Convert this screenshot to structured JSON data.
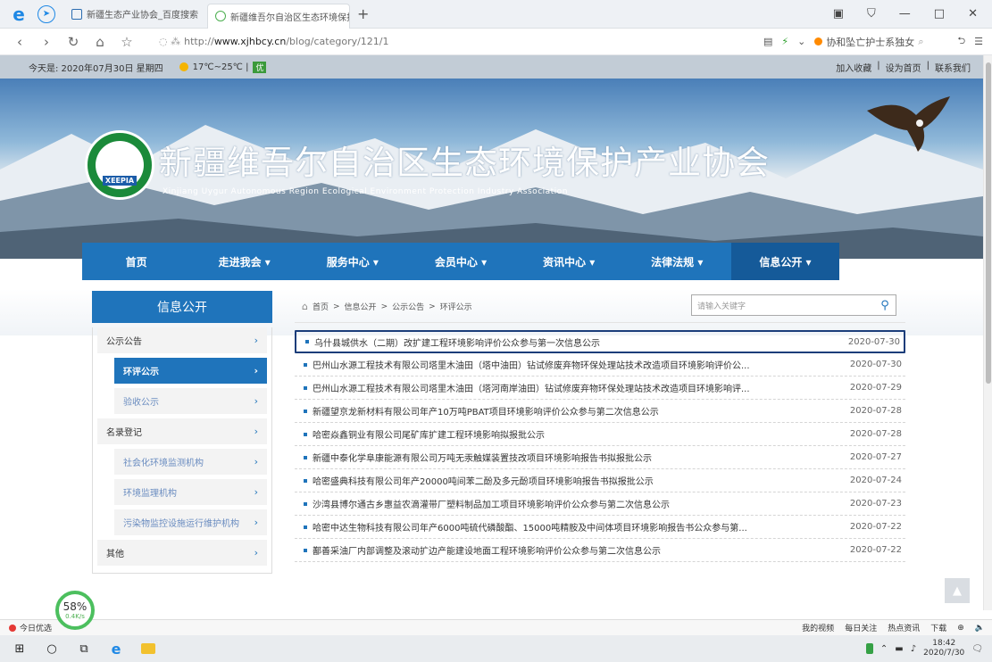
{
  "browser": {
    "tabs": [
      {
        "label": "新疆生态产业协会_百度搜索",
        "active": false
      },
      {
        "label": "新疆维吾尔自治区生态环境保护",
        "active": true
      }
    ],
    "url_prefix": "http://",
    "url_domain": "www.xjhbcy.cn",
    "url_path": "/blog/category/121/1",
    "search_text": "协和坠亡护士系独女",
    "win_min": "—",
    "win_max": "□",
    "win_close": "✕"
  },
  "topbar": {
    "date": "今天是: 2020年07月30日 星期四",
    "temp": "17℃~25℃ |",
    "air": "优",
    "links": [
      "加入收藏",
      "|",
      "设为首页",
      "|",
      "联系我们"
    ]
  },
  "banner": {
    "title": "新疆维吾尔自治区生态环境保护产业协会",
    "subtitle": "Xinjiang Uygur Autonomous Region Ecological Environment Protection Industry Association",
    "logo_text": "XEEPIA"
  },
  "nav": [
    {
      "label": "首页",
      "on": false
    },
    {
      "label": "走进我会 ▾",
      "on": false
    },
    {
      "label": "服务中心 ▾",
      "on": false
    },
    {
      "label": "会员中心 ▾",
      "on": false
    },
    {
      "label": "资讯中心 ▾",
      "on": false
    },
    {
      "label": "法律法规 ▾",
      "on": false
    },
    {
      "label": "信息公开 ▾",
      "on": true
    }
  ],
  "sidebar": {
    "title": "信息公开",
    "items": [
      {
        "label": "公示公告",
        "arrow": "›"
      },
      {
        "label": "环评公示",
        "arrow": "›"
      },
      {
        "label": "验收公示",
        "arrow": "›"
      },
      {
        "label": "名录登记",
        "arrow": "›"
      },
      {
        "label": "社会化环境监测机构",
        "arrow": "›"
      },
      {
        "label": "环境监理机构",
        "arrow": "›"
      },
      {
        "label": "污染物监控设施运行维护机构",
        "arrow": "›"
      },
      {
        "label": "其他",
        "arrow": "›"
      }
    ]
  },
  "breadcrumb": {
    "home": "首页",
    "sep": ">",
    "path1": "信息公开",
    "path2": "公示公告",
    "path3": "环评公示"
  },
  "search": {
    "placeholder": "请输入关键字"
  },
  "news": [
    {
      "title": "乌什县城供水（二期）改扩建工程环境影响评价公众参与第一次信息公示",
      "date": "2020-07-30"
    },
    {
      "title": "巴州山水源工程技术有限公司塔里木油田（塔中油田）钻试修废弃物环保处理站技术改造项目环境影响评价公...",
      "date": "2020-07-30"
    },
    {
      "title": "巴州山水源工程技术有限公司塔里木油田（塔河南岸油田）钻试修废弃物环保处理站技术改造项目环境影响评...",
      "date": "2020-07-29"
    },
    {
      "title": "新疆望京龙新材料有限公司年产10万吨PBAT项目环境影响评价公众参与第二次信息公示",
      "date": "2020-07-28"
    },
    {
      "title": "哈密焱鑫铜业有限公司尾矿库扩建工程环境影响拟报批公示",
      "date": "2020-07-28"
    },
    {
      "title": "新疆中泰化学阜康能源有限公司万吨无汞触媒装置技改项目环境影响报告书拟报批公示",
      "date": "2020-07-27"
    },
    {
      "title": "哈密盛典科技有限公司年产20000吨间苯二酚及多元酚项目环境影响报告书拟报批公示",
      "date": "2020-07-24"
    },
    {
      "title": "沙湾县博尔通古乡惠益农滴灌带厂塑料制品加工项目环境影响评价公众参与第二次信息公示",
      "date": "2020-07-23"
    },
    {
      "title": "哈密中达生物科技有限公司年产6000吨硫代磷酸酯、15000吨精胺及中间体项目环境影响报告书公众参与第...",
      "date": "2020-07-22"
    },
    {
      "title": "鄯善采油厂内部调整及滚动扩边产能建设地面工程环境影响评价公众参与第二次信息公示",
      "date": "2020-07-22"
    }
  ],
  "speed": {
    "percent": "58%",
    "rate": "0.4K/s"
  },
  "statusbar": {
    "left": "今日优选",
    "items": [
      "我的视频",
      "每日关注",
      "热点资讯",
      "下载"
    ]
  },
  "taskbar": {
    "time": "18:42",
    "date": "2020/7/30"
  }
}
